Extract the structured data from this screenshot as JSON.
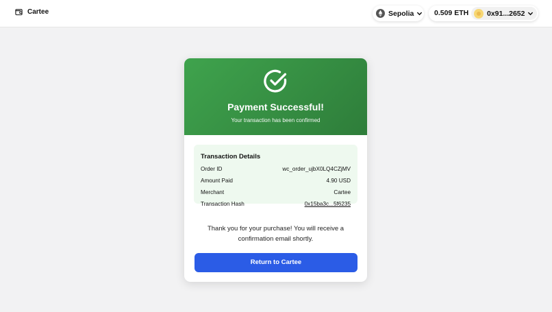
{
  "header": {
    "brand": "Cartee",
    "network": "Sepolia",
    "balance": "0.509 ETH",
    "address": "0x91...2652"
  },
  "card": {
    "title": "Payment Successful!",
    "subtitle": "Your transaction has been confirmed",
    "details": {
      "heading": "Transaction Details",
      "rows": [
        {
          "label": "Order ID",
          "value": "wc_order_ujbX0LQ4CZjMV"
        },
        {
          "label": "Amount Paid",
          "value": "4.90 USD"
        },
        {
          "label": "Merchant",
          "value": "Cartee"
        },
        {
          "label": "Transaction Hash",
          "value": "0x15ba3c...5f6235"
        }
      ]
    },
    "thank_you": "Thank you for your purchase! You will receive a confirmation email shortly.",
    "return_button": "Return to Cartee"
  },
  "colors": {
    "header_green": "#3fa34d",
    "details_bg": "#eef9ef",
    "button_blue": "#2b5ce6"
  }
}
